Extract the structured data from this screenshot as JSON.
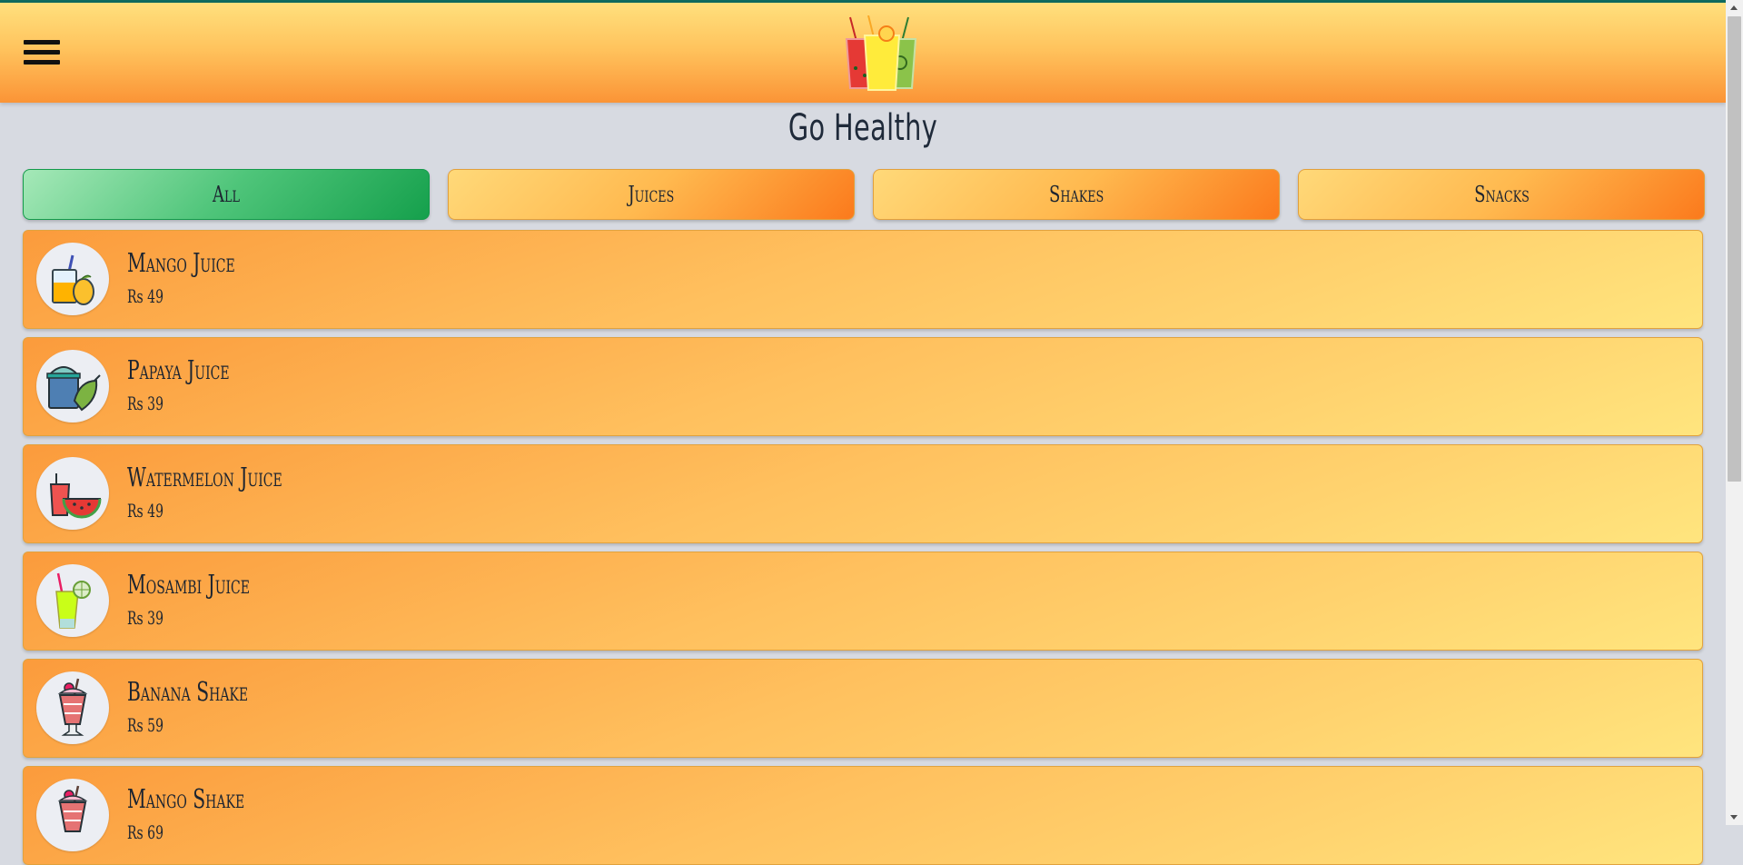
{
  "header": {
    "menu_icon": "hamburger-menu-icon",
    "logo_icon": "juice-glasses-logo"
  },
  "page": {
    "title": "Go Healthy"
  },
  "tabs": [
    {
      "label": "All",
      "active": true
    },
    {
      "label": "Juices",
      "active": false
    },
    {
      "label": "Shakes",
      "active": false
    },
    {
      "label": "Snacks",
      "active": false
    }
  ],
  "items": [
    {
      "name": "Mango Juice",
      "price": "Rs 49",
      "icon": "mango-juice-icon"
    },
    {
      "name": "Papaya Juice",
      "price": "Rs 39",
      "icon": "papaya-juice-icon"
    },
    {
      "name": "Watermelon Juice",
      "price": "Rs 49",
      "icon": "watermelon-juice-icon"
    },
    {
      "name": "Mosambi Juice",
      "price": "Rs 39",
      "icon": "mosambi-juice-icon"
    },
    {
      "name": "Banana Shake",
      "price": "Rs 59",
      "icon": "banana-shake-icon"
    },
    {
      "name": "Mango Shake",
      "price": "Rs 69",
      "icon": "mango-shake-icon"
    }
  ],
  "colors": {
    "header_top": "#ffe07d",
    "header_bottom": "#fb9436",
    "active_tab": "#15a04c",
    "card": "#ffc05e",
    "page_bg": "#d7dae1",
    "text": "#1c2430"
  }
}
